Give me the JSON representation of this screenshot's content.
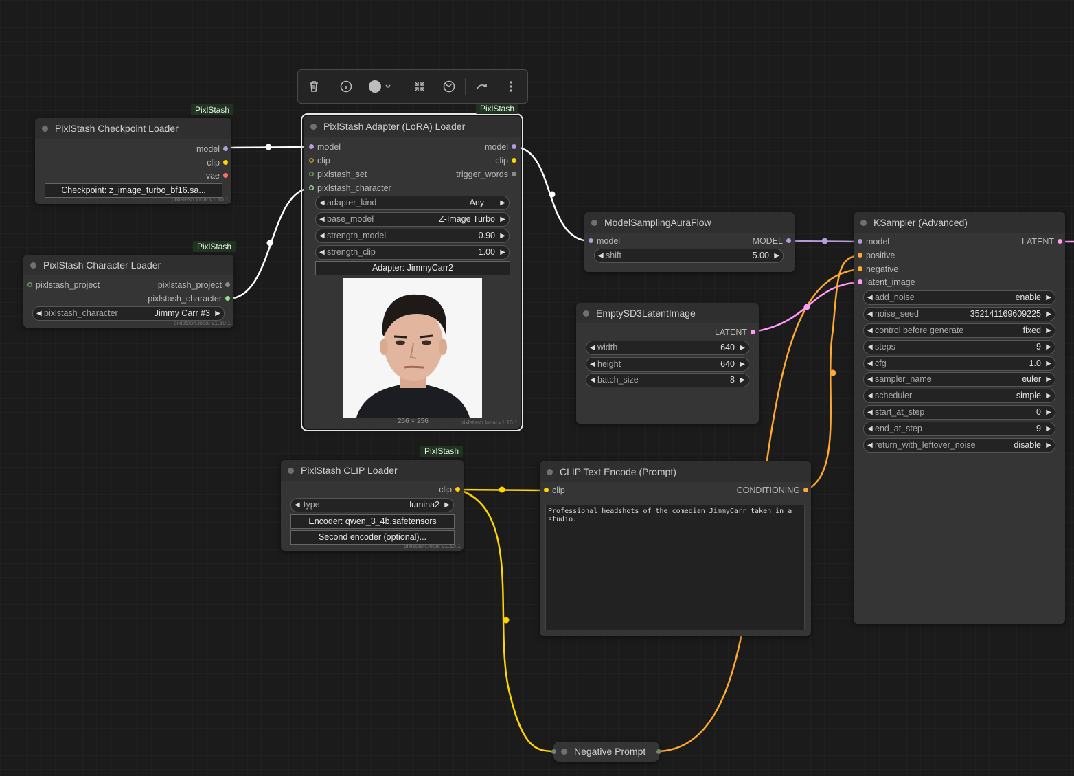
{
  "toolbar": {
    "buttons": [
      "trash-icon",
      "info-icon",
      "color-picker-icon",
      "collapse-icon",
      "bypass-icon",
      "redo-icon",
      "more-icon"
    ]
  },
  "colors": {
    "model": "#b39ddb",
    "clip": "#ffd500",
    "vae": "#ff6e6e",
    "conditioning": "#ffa931",
    "latent": "#ff9cf9",
    "pixlstash_character": "#8fe08f",
    "white_link": "#ffffff"
  },
  "checkpoint_loader": {
    "badge": "PixlStash",
    "title": "PixlStash Checkpoint Loader",
    "outputs": [
      "model",
      "clip",
      "vae"
    ],
    "checkpoint_button": "Checkpoint: z_image_turbo_bf16.sa...",
    "version": "pixlstash.local v1.10.1"
  },
  "character_loader": {
    "badge": "PixlStash",
    "title": "PixlStash Character Loader",
    "input": "pixlstash_project",
    "outputs": [
      "pixlstash_project",
      "pixlstash_character"
    ],
    "widget_label": "pixlstash_character",
    "widget_value": "Jimmy Carr #3",
    "version": "pixlstash.local v1.10.1"
  },
  "adapter_loader": {
    "badge": "PixlStash",
    "title": "PixlStash Adapter (LoRA) Loader",
    "inputs": [
      "model",
      "clip",
      "pixlstash_set",
      "pixlstash_character"
    ],
    "outputs": [
      "model",
      "clip",
      "trigger_words"
    ],
    "widgets": [
      {
        "label": "adapter_kind",
        "value": "— Any —"
      },
      {
        "label": "base_model",
        "value": "Z-Image Turbo"
      },
      {
        "label": "strength_model",
        "value": "0.90"
      },
      {
        "label": "strength_clip",
        "value": "1.00"
      }
    ],
    "adapter_button": "Adapter: JimmyCarr2",
    "image_size": "256 × 256",
    "version": "pixlstash.local v1.10.1"
  },
  "model_sampling": {
    "title": "ModelSamplingAuraFlow",
    "input": "model",
    "output": "MODEL",
    "widget_label": "shift",
    "widget_value": "5.00"
  },
  "empty_latent": {
    "title": "EmptySD3LatentImage",
    "output": "LATENT",
    "widgets": [
      {
        "label": "width",
        "value": "640"
      },
      {
        "label": "height",
        "value": "640"
      },
      {
        "label": "batch_size",
        "value": "8"
      }
    ]
  },
  "ksampler": {
    "title": "KSampler (Advanced)",
    "inputs": [
      "model",
      "positive",
      "negative",
      "latent_image"
    ],
    "output": "LATENT",
    "widgets": [
      {
        "label": "add_noise",
        "value": "enable"
      },
      {
        "label": "noise_seed",
        "value": "352141169609225"
      },
      {
        "label": "control before generate",
        "value": "fixed"
      },
      {
        "label": "steps",
        "value": "9"
      },
      {
        "label": "cfg",
        "value": "1.0"
      },
      {
        "label": "sampler_name",
        "value": "euler"
      },
      {
        "label": "scheduler",
        "value": "simple"
      },
      {
        "label": "start_at_step",
        "value": "0"
      },
      {
        "label": "end_at_step",
        "value": "9"
      },
      {
        "label": "return_with_leftover_noise",
        "value": "disable"
      }
    ]
  },
  "clip_loader": {
    "badge": "PixlStash",
    "title": "PixlStash CLIP Loader",
    "output": "clip",
    "widget_label": "type",
    "widget_value": "lumina2",
    "encoder_button": "Encoder: qwen_3_4b.safetensors",
    "second_encoder_button": "Second encoder (optional)...",
    "version": "pixlstash.local v1.10.1"
  },
  "clip_text_encode": {
    "title": "CLIP Text Encode (Prompt)",
    "input": "clip",
    "output": "CONDITIONING",
    "prompt": "Professional headshots of the comedian JimmyCarr taken in a studio."
  },
  "negative_prompt": {
    "title": "Negative Prompt"
  }
}
